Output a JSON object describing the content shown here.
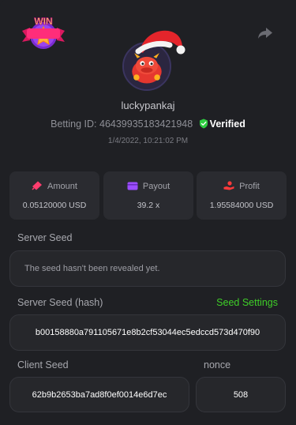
{
  "header": {
    "badge_text": "WIN",
    "share_icon": "share-arrow-icon"
  },
  "profile": {
    "username": "luckypankaj",
    "betting_id_label": "Betting ID:",
    "betting_id": "46439935183421948",
    "verified_label": "Verified",
    "datetime": "1/4/2022, 10:21:02 PM"
  },
  "stats": {
    "amount": {
      "label": "Amount",
      "value": "0.05120000 USD",
      "icon": "ticket-icon",
      "color": "#ff3d6e"
    },
    "payout": {
      "label": "Payout",
      "value": "39.2 x",
      "icon": "wallet-icon",
      "color": "#9b4dff"
    },
    "profit": {
      "label": "Profit",
      "value": "1.95584000 USD",
      "icon": "hand-coin-icon",
      "color": "#ff3b3b"
    }
  },
  "server_seed": {
    "label": "Server Seed",
    "value": "The seed hasn't been revealed yet."
  },
  "server_seed_hash": {
    "label": "Server Seed (hash)",
    "settings_link": "Seed Settings",
    "value": "b00158880a791105671e8b2cf53044ec5edccd573d470f90"
  },
  "client_seed": {
    "label": "Client Seed",
    "value": "62b9b2653ba7ad8f0ef0014e6d7ec"
  },
  "nonce": {
    "label": "nonce",
    "value": "508"
  },
  "colors": {
    "background": "#1f2024",
    "card": "#2a2b30",
    "accent_green": "#3fcf28",
    "verified_green": "#2ecc40"
  }
}
